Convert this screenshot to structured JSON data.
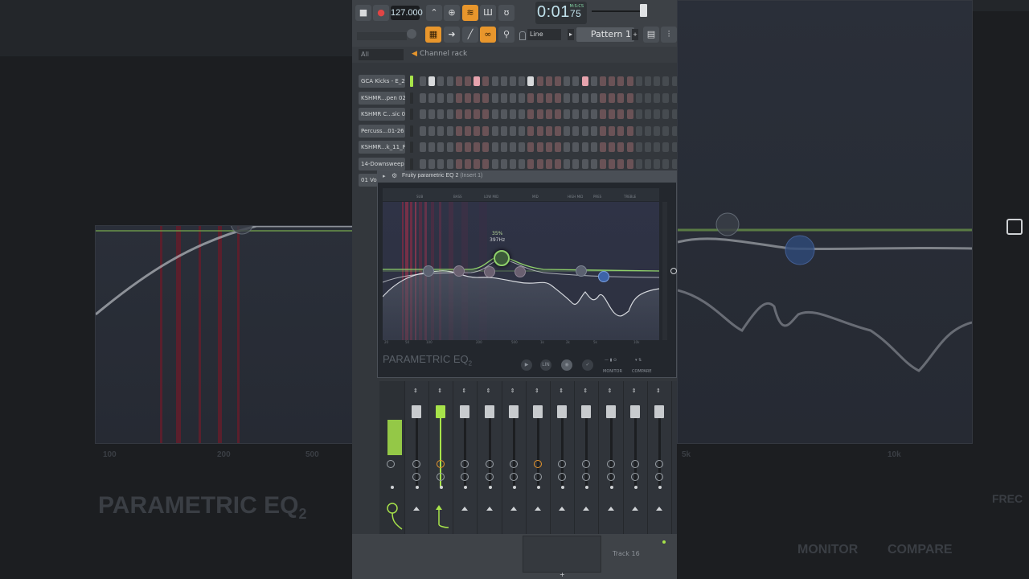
{
  "toolbar": {
    "tempo": "127.000",
    "time": "0:01",
    "time_fraction": "75",
    "time_unit": "M:S:CS",
    "snap": "Line",
    "pattern": "Pattern 1"
  },
  "channel_rack": {
    "filter": "All",
    "title": "Channel rack",
    "channels": [
      {
        "name": "GCA Kicks - E_2"
      },
      {
        "name": "KSHMR...pen 02"
      },
      {
        "name": "KSHMR C...sic 03"
      },
      {
        "name": "Percuss...01-26"
      },
      {
        "name": "KSHMR...k_11_F"
      },
      {
        "name": "14-Downsweep"
      },
      {
        "name": "01 Vo"
      }
    ]
  },
  "eq": {
    "title": "Fruity parametric EQ 2",
    "insert": "(Insert 1)",
    "bands_top": [
      "SUB",
      "BASS",
      "LOW MID",
      "MID",
      "HIGH MID",
      "PRES",
      "TREBLE"
    ],
    "active_gain": "35%",
    "active_freq": "397Hz",
    "brand": "PARAMETRIC EQ",
    "brand_num": "2",
    "lin_label": "LIN",
    "monitor_label": "MONITOR",
    "compare_label": "COMPARE",
    "freq_marks": [
      "20",
      "50",
      "100",
      "200",
      "500",
      "1k",
      "2k",
      "5k",
      "10k"
    ]
  },
  "track": {
    "label": "Track 16"
  },
  "bg": {
    "brand_left": "PARAMETRIC EQ",
    "brand_sub": "2",
    "monitor": "MONITOR",
    "compare": "COMPARE",
    "freq_left": [
      "100",
      "200",
      "500"
    ],
    "freq_right": [
      "5k",
      "10k"
    ],
    "side_right": "FREC"
  },
  "colors": {
    "accent": "#e8962c",
    "green": "#a7e34a",
    "eq_curve": "#8fd16a",
    "stripe": "#b0304a"
  }
}
